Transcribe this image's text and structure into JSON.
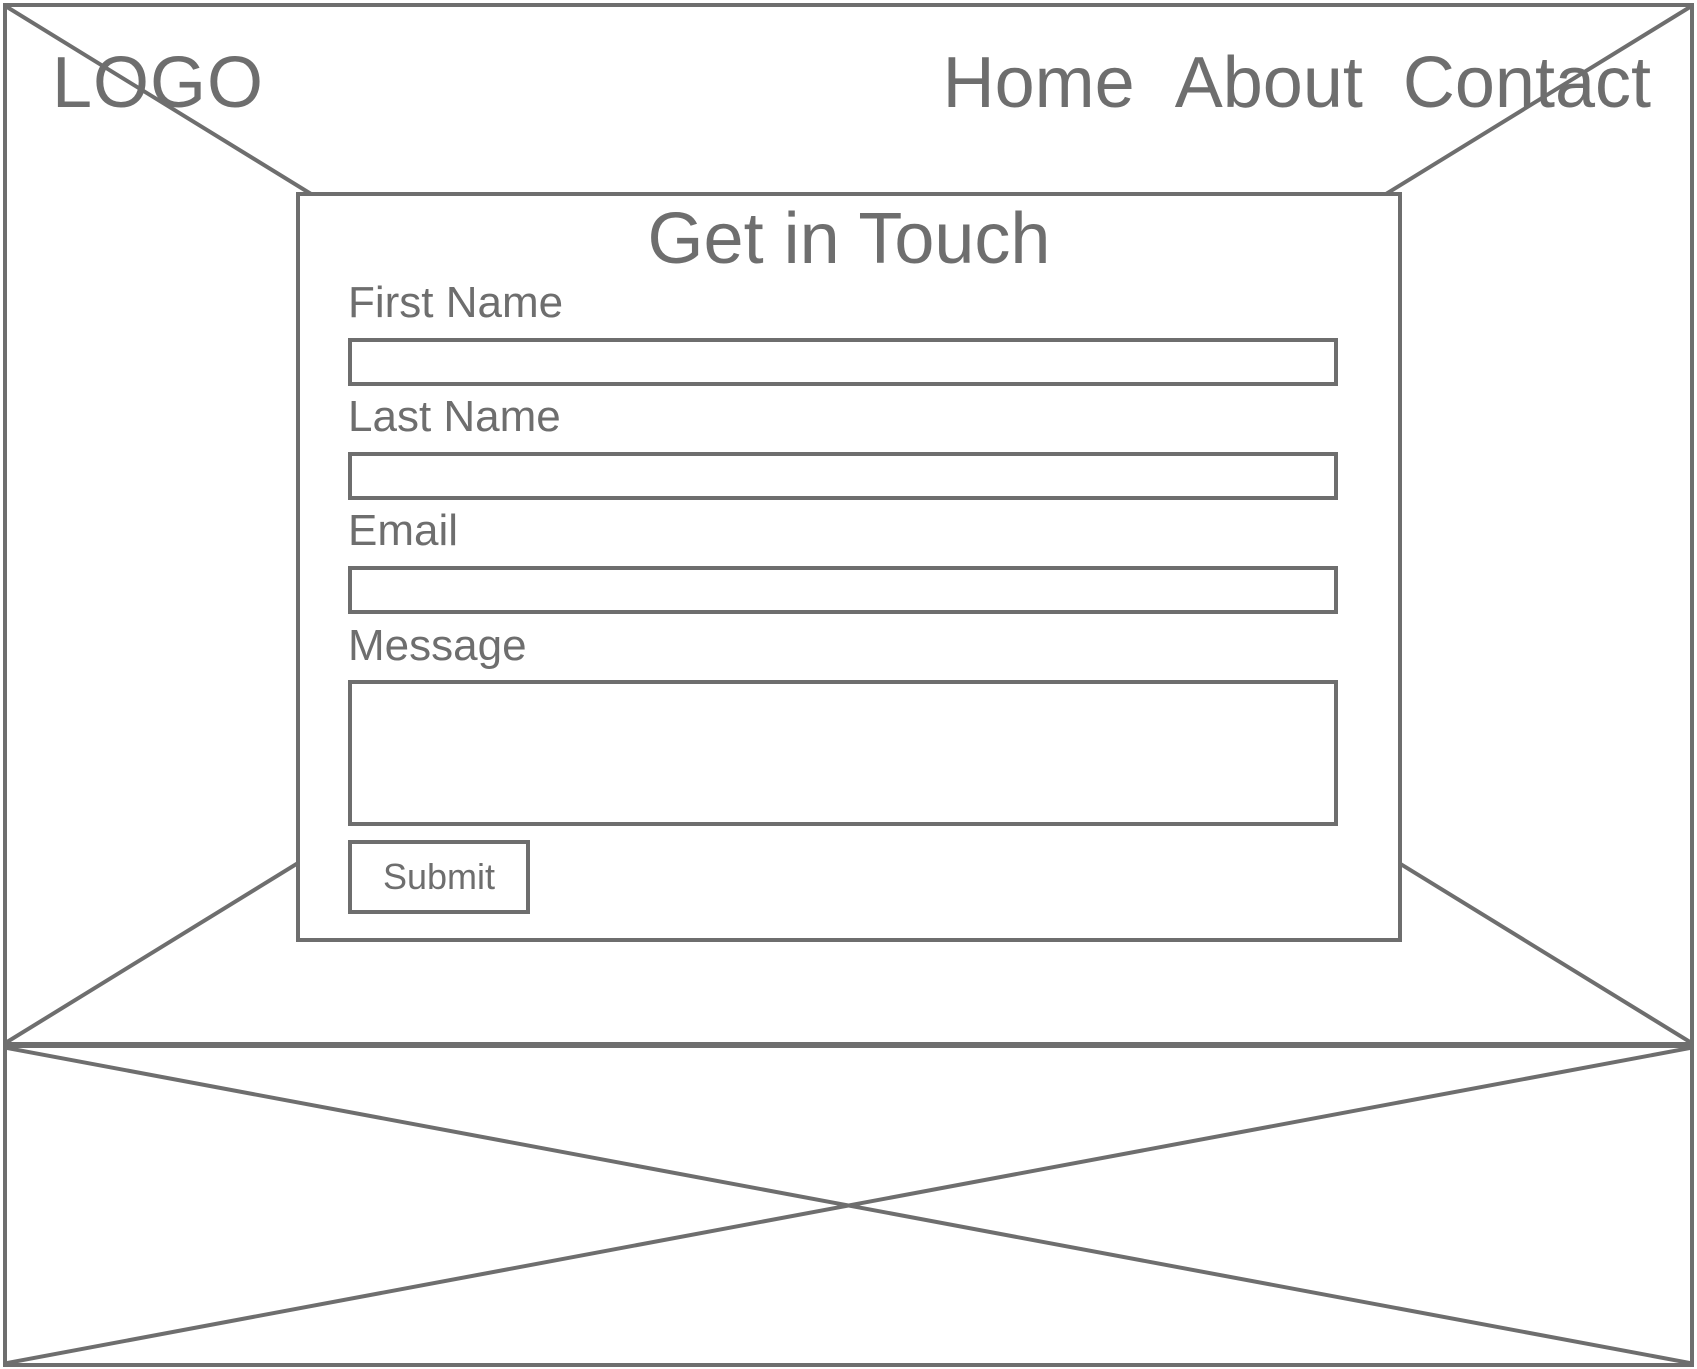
{
  "header": {
    "logo": "LOGO",
    "nav": [
      "Home",
      "About",
      "Contact"
    ]
  },
  "contact_form": {
    "title": "Get in Touch",
    "fields": [
      {
        "label": "First Name",
        "value": ""
      },
      {
        "label": "Last Name",
        "value": ""
      },
      {
        "label": "Email",
        "value": ""
      },
      {
        "label": "Message",
        "value": ""
      }
    ],
    "submit_label": "Submit"
  },
  "colors": {
    "stroke": "#6e6e6e",
    "background": "#ffffff"
  }
}
